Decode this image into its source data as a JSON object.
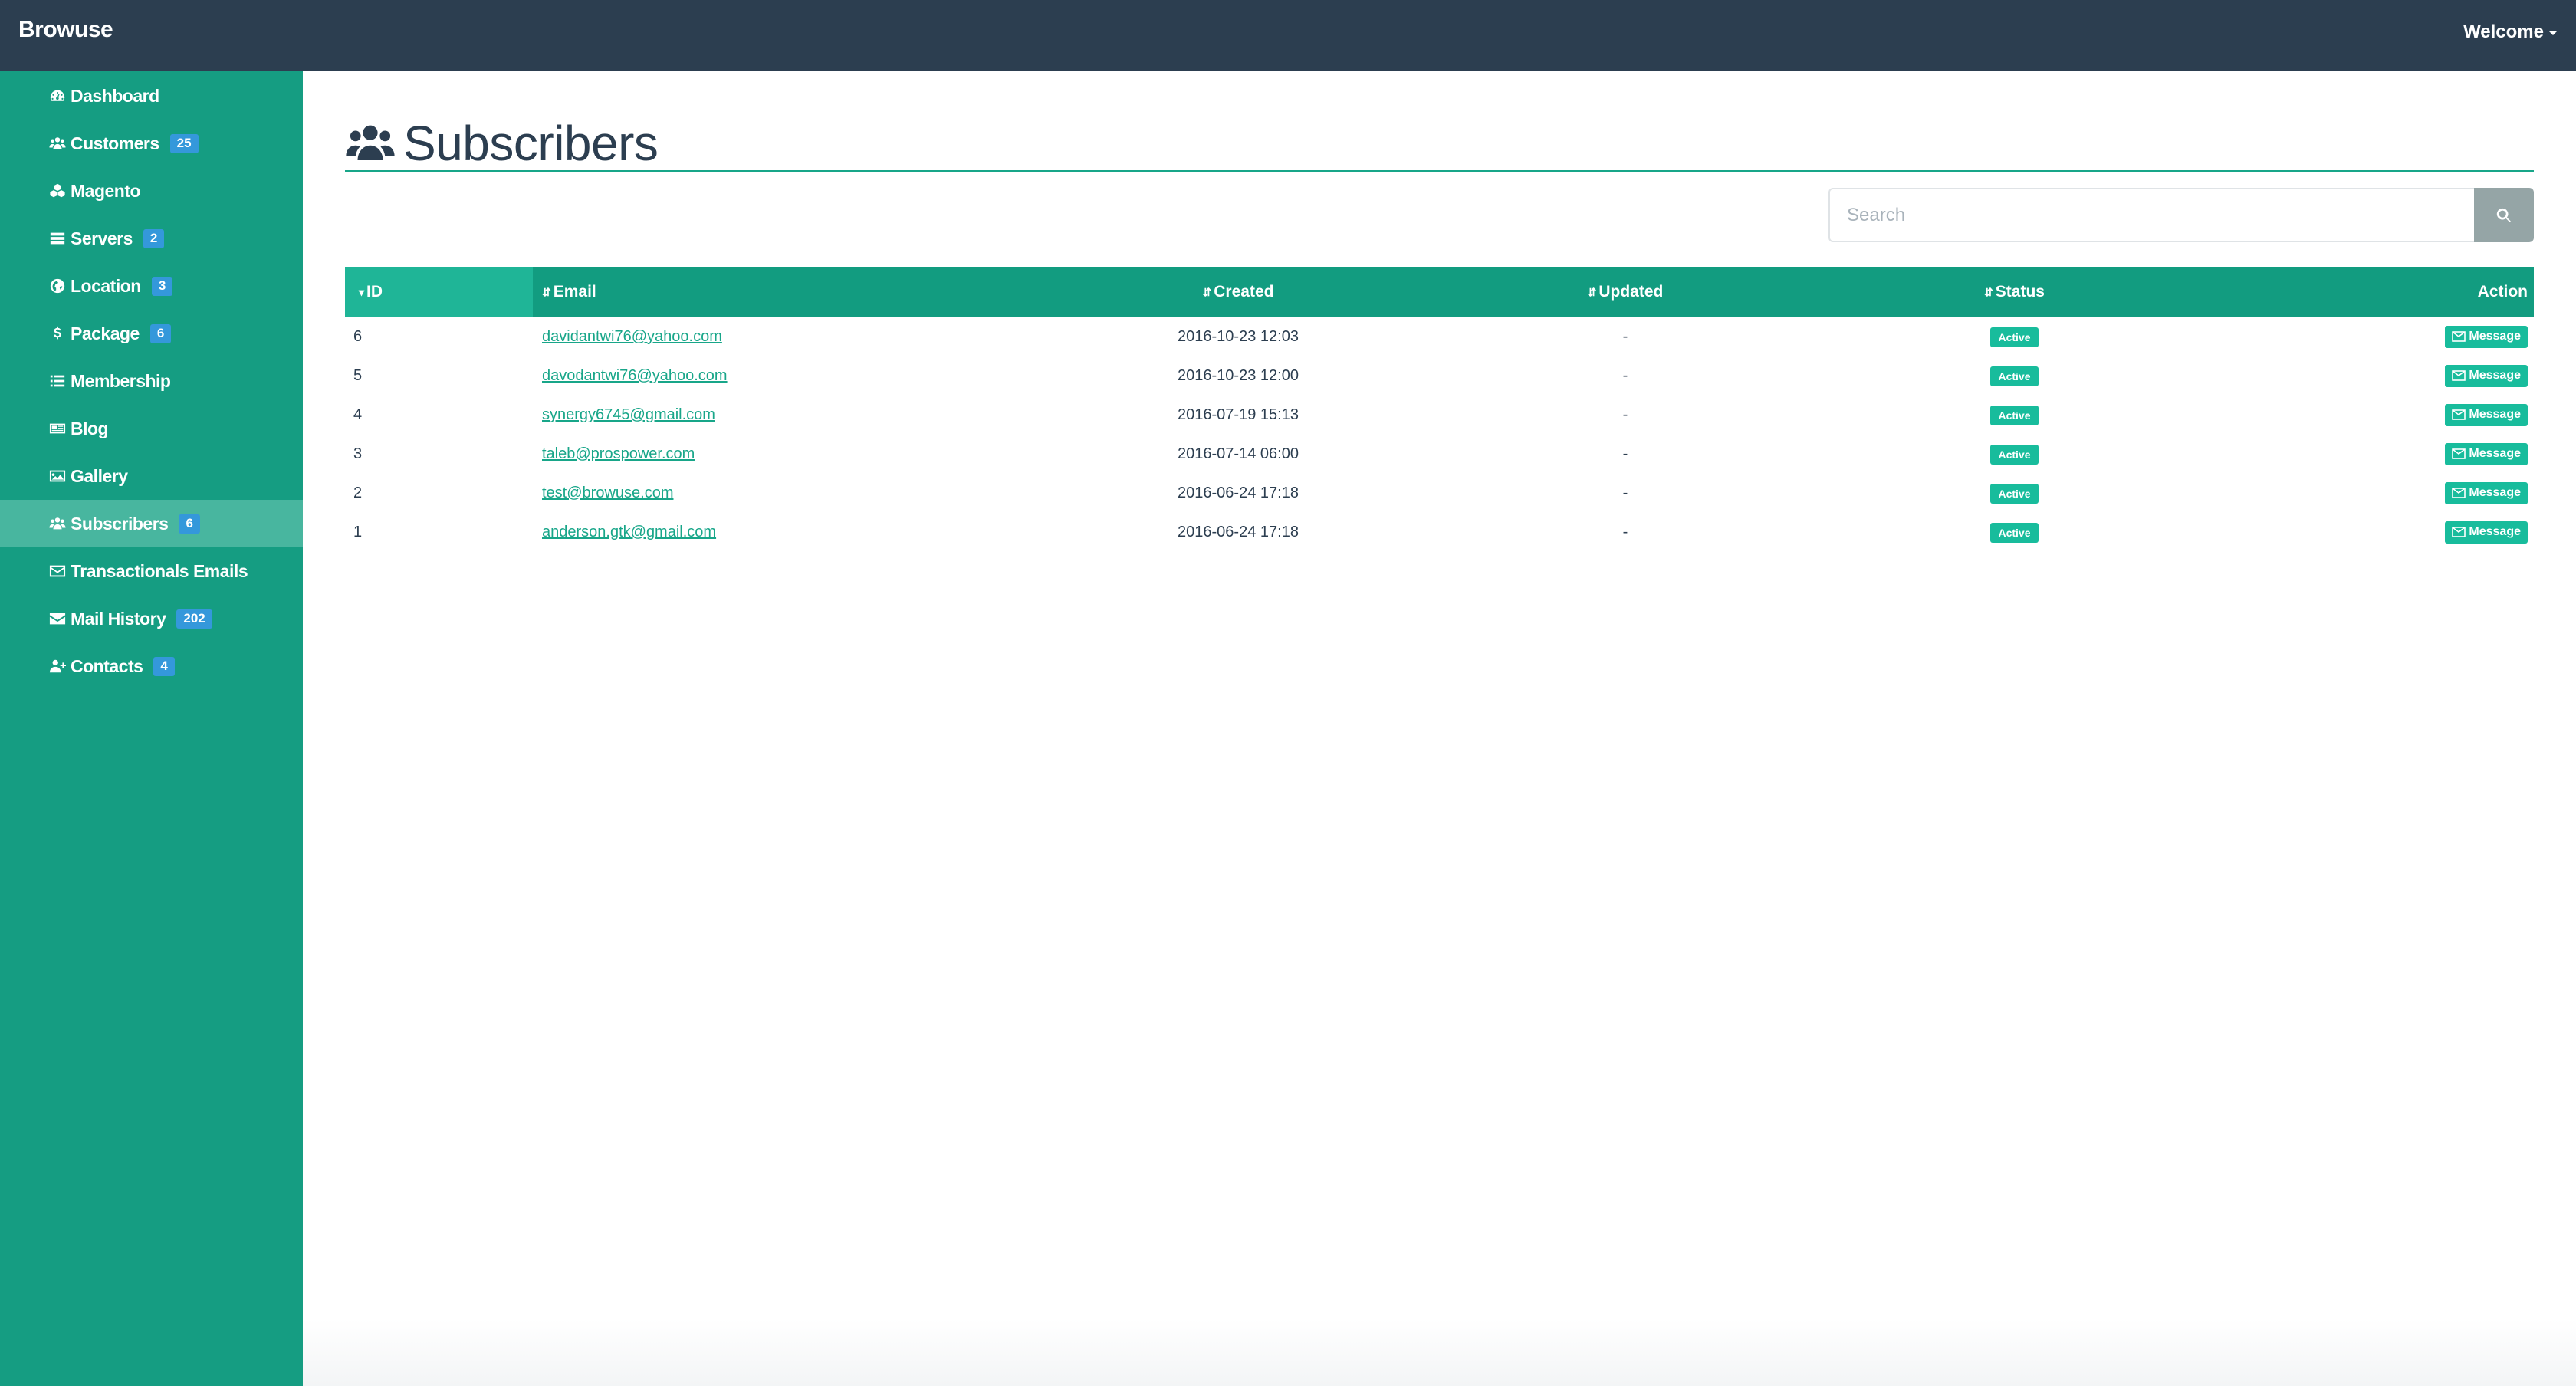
{
  "navbar": {
    "brand": "Browuse",
    "welcome": "Welcome"
  },
  "sidebar": {
    "items": [
      {
        "label": "Dashboard",
        "icon": "dashboard-icon",
        "badge": ""
      },
      {
        "label": "Customers",
        "icon": "users-icon",
        "badge": "25"
      },
      {
        "label": "Magento",
        "icon": "cubes-icon",
        "badge": ""
      },
      {
        "label": "Servers",
        "icon": "server-icon",
        "badge": "2"
      },
      {
        "label": "Location",
        "icon": "globe-icon",
        "badge": "3"
      },
      {
        "label": "Package",
        "icon": "dollar-icon",
        "badge": "6"
      },
      {
        "label": "Membership",
        "icon": "list-icon",
        "badge": ""
      },
      {
        "label": "Blog",
        "icon": "newspaper-icon",
        "badge": ""
      },
      {
        "label": "Gallery",
        "icon": "image-icon",
        "badge": ""
      },
      {
        "label": "Subscribers",
        "icon": "users-icon",
        "badge": "6",
        "active": true
      },
      {
        "label": "Transactionals Emails",
        "icon": "envelope-outline-icon",
        "badge": ""
      },
      {
        "label": "Mail History",
        "icon": "envelope-icon",
        "badge": "202"
      },
      {
        "label": "Contacts",
        "icon": "user-plus-icon",
        "badge": "4"
      }
    ]
  },
  "main": {
    "title": "Subscribers",
    "title_icon": "users-icon",
    "search": {
      "placeholder": "Search",
      "value": ""
    },
    "table": {
      "columns": [
        "ID",
        "Email",
        "Created",
        "Updated",
        "Status",
        "Action"
      ],
      "rows": [
        {
          "id": "6",
          "email": "davidantwi76@yahoo.com",
          "created": "2016-10-23 12:03",
          "updated": "-",
          "status": "Active",
          "action": "Message"
        },
        {
          "id": "5",
          "email": "davodantwi76@yahoo.com",
          "created": "2016-10-23 12:00",
          "updated": "-",
          "status": "Active",
          "action": "Message"
        },
        {
          "id": "4",
          "email": "synergy6745@gmail.com",
          "created": "2016-07-19 15:13",
          "updated": "-",
          "status": "Active",
          "action": "Message"
        },
        {
          "id": "3",
          "email": "taleb@prospower.com",
          "created": "2016-07-14 06:00",
          "updated": "-",
          "status": "Active",
          "action": "Message"
        },
        {
          "id": "2",
          "email": "test@browuse.com",
          "created": "2016-06-24 17:18",
          "updated": "-",
          "status": "Active",
          "action": "Message"
        },
        {
          "id": "1",
          "email": "anderson.gtk@gmail.com",
          "created": "2016-06-24 17:18",
          "updated": "-",
          "status": "Active",
          "action": "Message"
        }
      ]
    }
  },
  "colors": {
    "navbar": "#2c3e50",
    "sidebar": "#159d82",
    "sidebar_active": "#48b69f",
    "table_header": "#129c80",
    "badge": "#3498db",
    "status": "#18bc9c"
  }
}
